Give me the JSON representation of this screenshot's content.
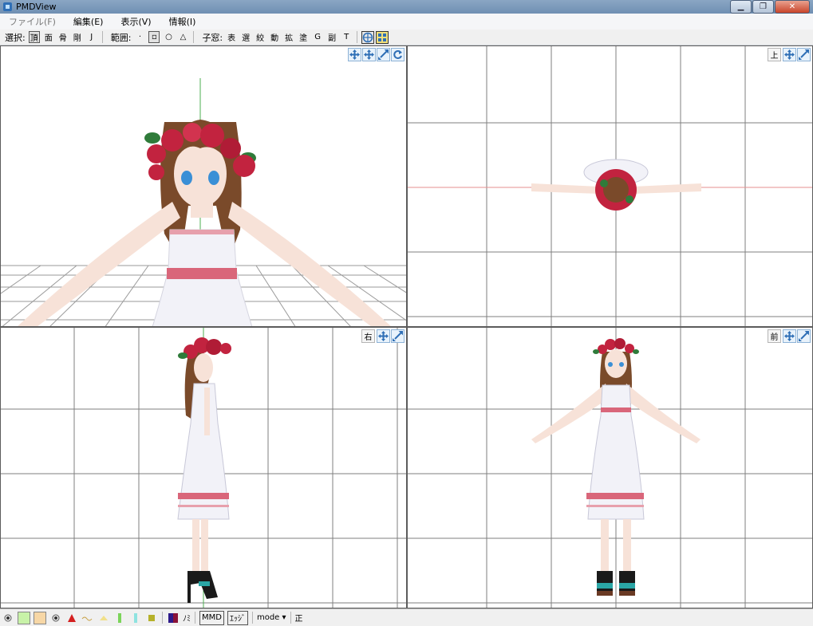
{
  "window": {
    "title": "PMDView",
    "minimize": "▁",
    "maximize": "❐",
    "close": "✕"
  },
  "menubar": {
    "items": [
      "ファイル(F)",
      "編集(E)",
      "表示(V)",
      "情報(I)"
    ]
  },
  "toolbar": {
    "select_label": "選択:",
    "select_buttons": [
      "頂",
      "面",
      "骨",
      "剛",
      "J"
    ],
    "range_label": "範囲:",
    "range_buttons": [
      "·",
      "▫",
      "○",
      "△"
    ],
    "child_label": "子窓:",
    "child_buttons": [
      "表",
      "選",
      "絞",
      "動",
      "拡",
      "塗",
      "G",
      "副",
      "T"
    ]
  },
  "viewports": {
    "perspective": {
      "name": "perspective"
    },
    "top": {
      "label": "上"
    },
    "side": {
      "label": "右"
    },
    "front": {
      "label": "前"
    }
  },
  "statusbar": {
    "mmd_label": "MMD",
    "edge_label": "ｴｯｼﾞ",
    "nomi_label": "ﾉﾐ",
    "mode_label": "mode ▾",
    "sei_label": "正"
  },
  "colors": {
    "grid": "#7f7f7f",
    "axis_green": "#4caf50",
    "axis_red": "#e58f8f",
    "hair": "#7a4a2a",
    "skin": "#f7e2d8",
    "dress": "#f2f2f8",
    "ribbon": "#d9667a",
    "rose": "#c2233f",
    "leaf": "#2f7b3a",
    "accent_blue": "#2f6fb6"
  }
}
